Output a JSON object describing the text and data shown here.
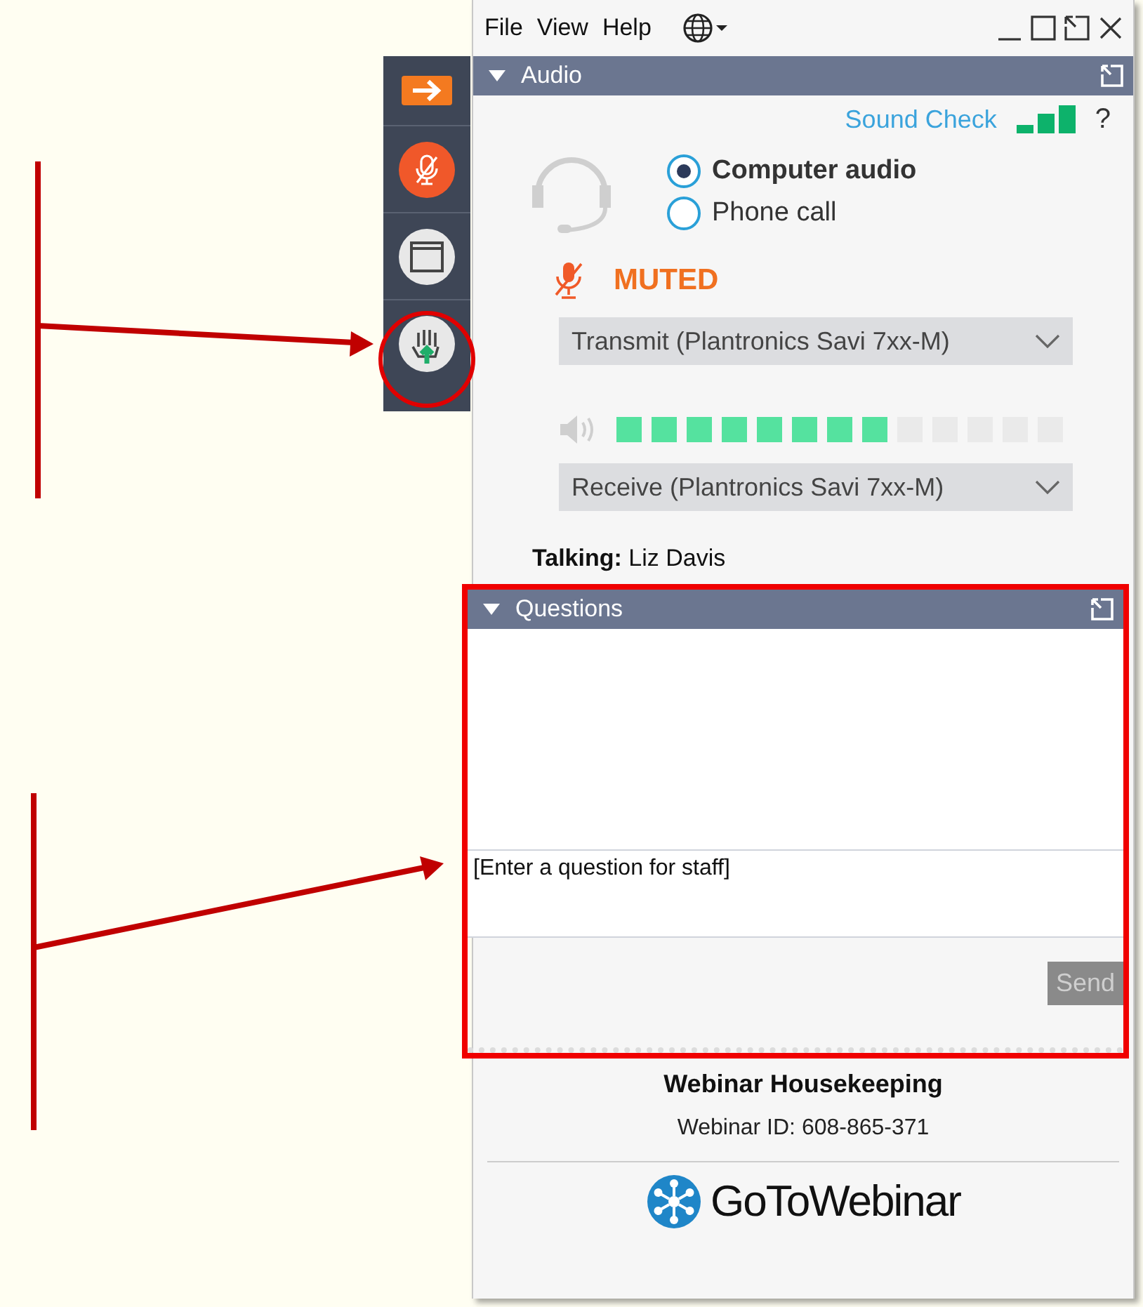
{
  "menu": [
    "File",
    "View",
    "Help"
  ],
  "audio": {
    "title": "Audio",
    "sound_check": "Sound Check",
    "help": "?",
    "options": [
      {
        "label": "Computer audio",
        "selected": true
      },
      {
        "label": "Phone call",
        "selected": false
      }
    ],
    "mic_status": "MUTED",
    "transmit": "Transmit (Plantronics Savi 7xx-M)",
    "speaker": {
      "level": 0.615
    },
    "receive": "Receive (Plantronics Savi 7xx-M)"
  },
  "talking": "**Talking:** Liz Davis",
  "questions": {
    "title": "Questions",
    "placeholder": "[Enter a question for staff]",
    "send": "Send"
  },
  "footer": {
    "title": "Webinar Housekeeping",
    "webinar_id": "Webinar ID: 608-865-371",
    "logo": "**GoTo**Webinar"
  }
}
